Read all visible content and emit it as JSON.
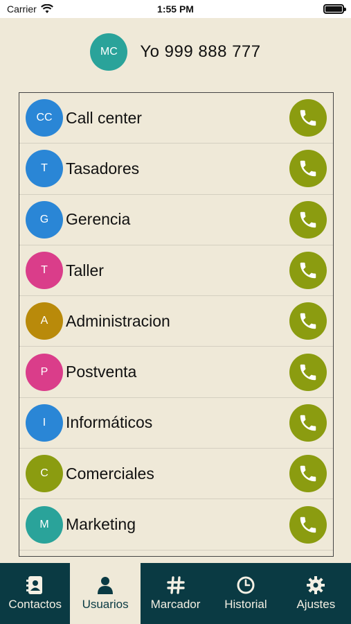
{
  "status": {
    "carrier": "Carrier",
    "time": "1:55 PM"
  },
  "header": {
    "avatar_initials": "MC",
    "avatar_color": "#2aa39a",
    "title": "Yo 999 888 777"
  },
  "contacts": [
    {
      "initials": "CC",
      "name": "Call center",
      "color": "#2a86d6"
    },
    {
      "initials": "T",
      "name": "Tasadores",
      "color": "#2a86d6"
    },
    {
      "initials": "G",
      "name": "Gerencia",
      "color": "#2a86d6"
    },
    {
      "initials": "T",
      "name": "Taller",
      "color": "#da3d8a"
    },
    {
      "initials": "A",
      "name": "Administracion",
      "color": "#b98a0a"
    },
    {
      "initials": "P",
      "name": "Postventa",
      "color": "#da3d8a"
    },
    {
      "initials": "I",
      "name": "Informáticos",
      "color": "#2a86d6"
    },
    {
      "initials": "C",
      "name": "Comerciales",
      "color": "#8b9c10"
    },
    {
      "initials": "M",
      "name": "Marketing",
      "color": "#2aa39a"
    }
  ],
  "call_button_color": "#8b9c10",
  "tabs": [
    {
      "label": "Contactos",
      "icon": "contacts-icon",
      "active": false
    },
    {
      "label": "Usuarios",
      "icon": "user-icon",
      "active": true
    },
    {
      "label": "Marcador",
      "icon": "hash-icon",
      "active": false
    },
    {
      "label": "Historial",
      "icon": "clock-icon",
      "active": false
    },
    {
      "label": "Ajustes",
      "icon": "gear-icon",
      "active": false
    }
  ]
}
